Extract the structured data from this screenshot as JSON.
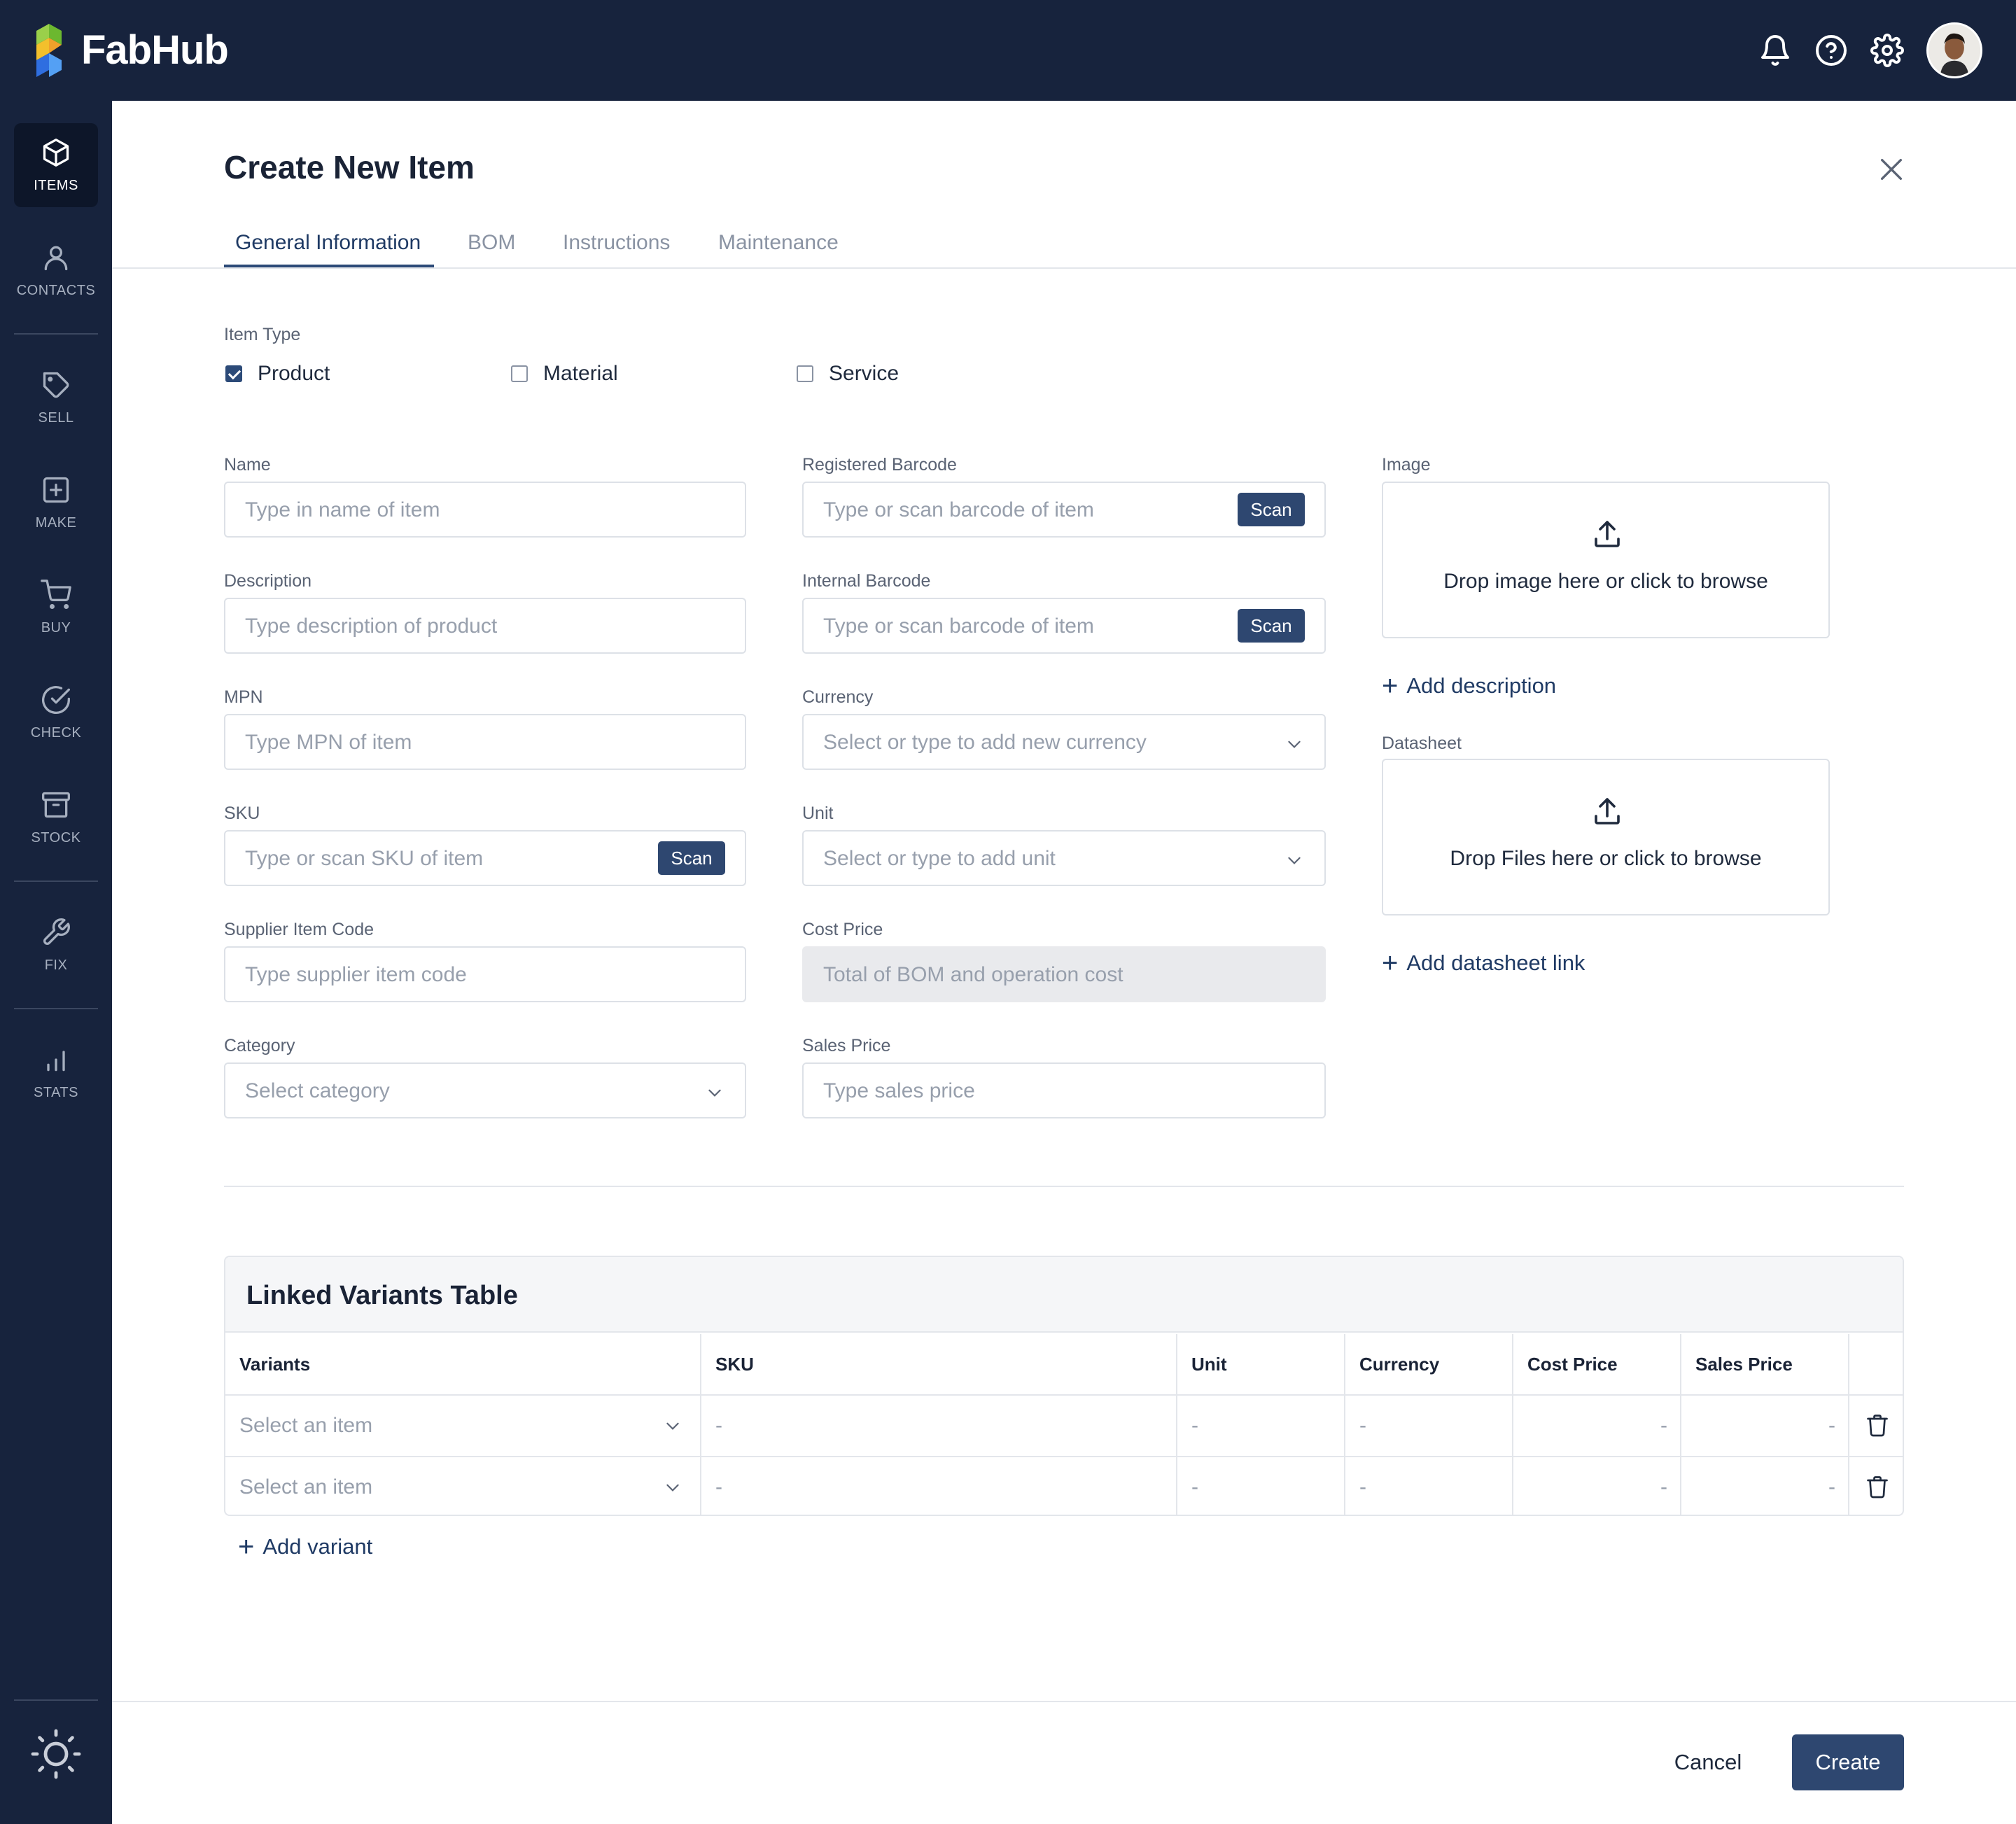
{
  "app": {
    "name": "FabHub",
    "brand_color": "#17233d",
    "accent_color": "#2e4770"
  },
  "topbar": {
    "icons": [
      "bell-icon",
      "help-icon",
      "settings-icon"
    ],
    "avatar": "user-avatar"
  },
  "sidebar": {
    "items": [
      {
        "label": "ITEMS",
        "icon": "cube-icon",
        "active": true
      },
      {
        "label": "CONTACTS",
        "icon": "person-icon",
        "active": false
      },
      {
        "label": "SELL",
        "icon": "tag-icon",
        "active": false
      },
      {
        "label": "MAKE",
        "icon": "plus-square-icon",
        "active": false
      },
      {
        "label": "BUY",
        "icon": "cart-icon",
        "active": false
      },
      {
        "label": "CHECK",
        "icon": "check-circle-icon",
        "active": false
      },
      {
        "label": "STOCK",
        "icon": "archive-icon",
        "active": false
      },
      {
        "label": "FIX",
        "icon": "wrench-icon",
        "active": false
      },
      {
        "label": "STATS",
        "icon": "bar-chart-icon",
        "active": false
      }
    ],
    "theme_icon": "sun-icon"
  },
  "page": {
    "title": "Create New Item",
    "tabs": [
      {
        "label": "General Information",
        "active": true
      },
      {
        "label": "BOM",
        "active": false
      },
      {
        "label": "Instructions",
        "active": false
      },
      {
        "label": "Maintenance",
        "active": false
      }
    ]
  },
  "item_type": {
    "label": "Item Type",
    "options": [
      {
        "label": "Product",
        "checked": true
      },
      {
        "label": "Material",
        "checked": false
      },
      {
        "label": "Service",
        "checked": false
      }
    ]
  },
  "form": {
    "name": {
      "label": "Name",
      "placeholder": "Type in name of item"
    },
    "description": {
      "label": "Description",
      "placeholder": "Type description of product"
    },
    "mpn": {
      "label": "MPN",
      "placeholder": "Type MPN of item"
    },
    "sku": {
      "label": "SKU",
      "placeholder": "Type or scan SKU of item",
      "button": "Scan"
    },
    "supplier_item_code": {
      "label": "Supplier Item Code",
      "placeholder": "Type supplier item code"
    },
    "category": {
      "label": "Category",
      "placeholder": "Select category"
    },
    "registered_barcode": {
      "label": "Registered Barcode",
      "placeholder": "Type or scan barcode of item",
      "button": "Scan"
    },
    "internal_barcode": {
      "label": "Internal Barcode",
      "placeholder": "Type or scan barcode of item",
      "button": "Scan"
    },
    "currency": {
      "label": "Currency",
      "placeholder": "Select or type to add new currency"
    },
    "unit": {
      "label": "Unit",
      "placeholder": "Select or type to add unit"
    },
    "cost_price": {
      "label": "Cost Price",
      "placeholder": "Total of BOM and operation cost"
    },
    "sales_price": {
      "label": "Sales Price",
      "placeholder": "Type sales price"
    }
  },
  "media": {
    "image": {
      "label": "Image",
      "dropzone_text": "Drop image here or click to browse"
    },
    "add_description": "Add description",
    "datasheet": {
      "label": "Datasheet",
      "dropzone_text": "Drop Files here or click to browse"
    },
    "add_datasheet_link": "Add datasheet link"
  },
  "variants_table": {
    "title": "Linked Variants Table",
    "columns": [
      "Variants",
      "SKU",
      "Unit",
      "Currency",
      "Cost Price",
      "Sales Price"
    ],
    "rows": [
      {
        "variant": "Select an item",
        "sku": "-",
        "unit": "-",
        "currency": "-",
        "cost_price": "-",
        "sales_price": "-"
      },
      {
        "variant": "Select an item",
        "sku": "-",
        "unit": "-",
        "currency": "-",
        "cost_price": "-",
        "sales_price": "-"
      }
    ],
    "add_variant": "Add variant"
  },
  "footer": {
    "cancel": "Cancel",
    "create": "Create"
  }
}
